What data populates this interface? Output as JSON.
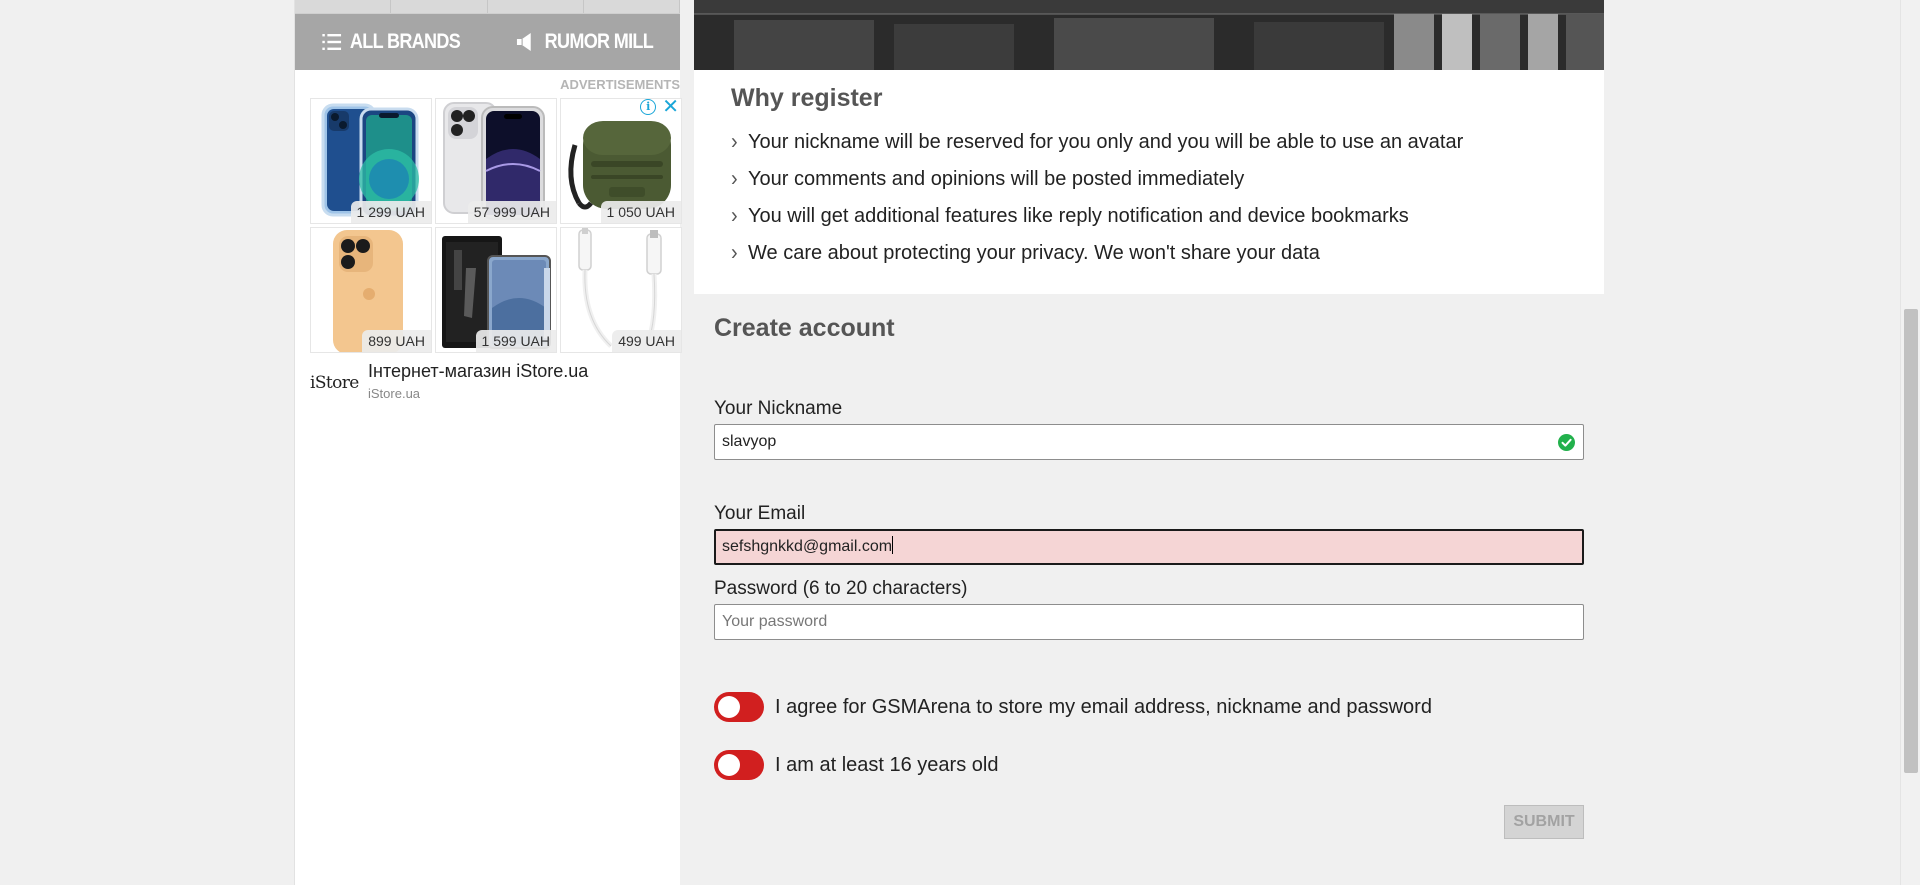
{
  "sidebar": {
    "nav": {
      "all_brands": "ALL BRANDS",
      "rumor_mill": "RUMOR MILL"
    },
    "ads": {
      "label": "ADVERTISEMENTS",
      "info_icon": "i",
      "close_icon": "✕",
      "items": [
        {
          "price": "1 299 UAH"
        },
        {
          "price": "57 999 UAH"
        },
        {
          "price": "1 050 UAH"
        },
        {
          "price": "899 UAH"
        },
        {
          "price": "1 599 UAH"
        },
        {
          "price": "499 UAH"
        }
      ],
      "advertiser": {
        "logo": "iStore",
        "name": "Інтернет-магазин iStore.ua",
        "domain": "iStore.ua"
      }
    }
  },
  "why_register": {
    "title": "Why register",
    "items": [
      "Your nickname will be reserved for you only and you will be able to use an avatar",
      "Your comments and opinions will be posted immediately",
      "You will get additional features like reply notification and device bookmarks",
      "We care about protecting your privacy. We won't share your data"
    ]
  },
  "create_account": {
    "title": "Create account",
    "nickname": {
      "label": "Your Nickname",
      "value": "slavyop"
    },
    "email": {
      "label": "Your Email",
      "value": "sefshgnkkd@gmail.com"
    },
    "password": {
      "label": "Password (6 to 20 characters)",
      "placeholder": "Your password"
    },
    "consents": {
      "store_data": "I agree for GSMArena to store my email address, nickname and password",
      "age": "I am at least 16 years old"
    },
    "submit_label": "SUBMIT"
  },
  "colors": {
    "toggle_off": "#d11f1f",
    "valid_check": "#22b14c",
    "error_field": "#f5d5d5",
    "nav_bar": "#a6a6a6"
  }
}
